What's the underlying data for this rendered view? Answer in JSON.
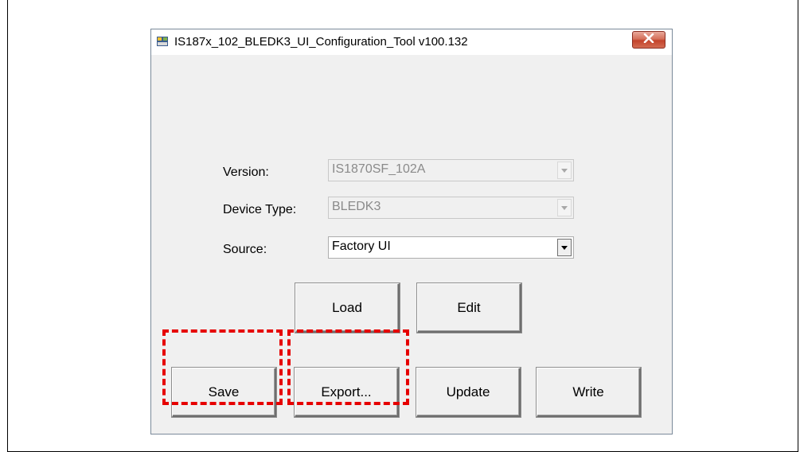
{
  "window": {
    "title": "IS187x_102_BLEDK3_UI_Configuration_Tool v100.132",
    "app_icon": "app-icon",
    "close_icon": "close-x-icon"
  },
  "form": {
    "version": {
      "label": "Version:",
      "value": "IS1870SF_102A",
      "enabled": false
    },
    "device_type": {
      "label": "Device Type:",
      "value": "BLEDK3",
      "enabled": false
    },
    "source": {
      "label": "Source:",
      "value": "Factory UI",
      "enabled": true
    }
  },
  "buttons": {
    "load": "Load",
    "edit": "Edit",
    "save": "Save",
    "export": "Export...",
    "update": "Update",
    "write": "Write"
  },
  "highlights": [
    "Save",
    "Export..."
  ],
  "colors": {
    "highlight": "#e60000",
    "close_button": "#c3432b"
  }
}
